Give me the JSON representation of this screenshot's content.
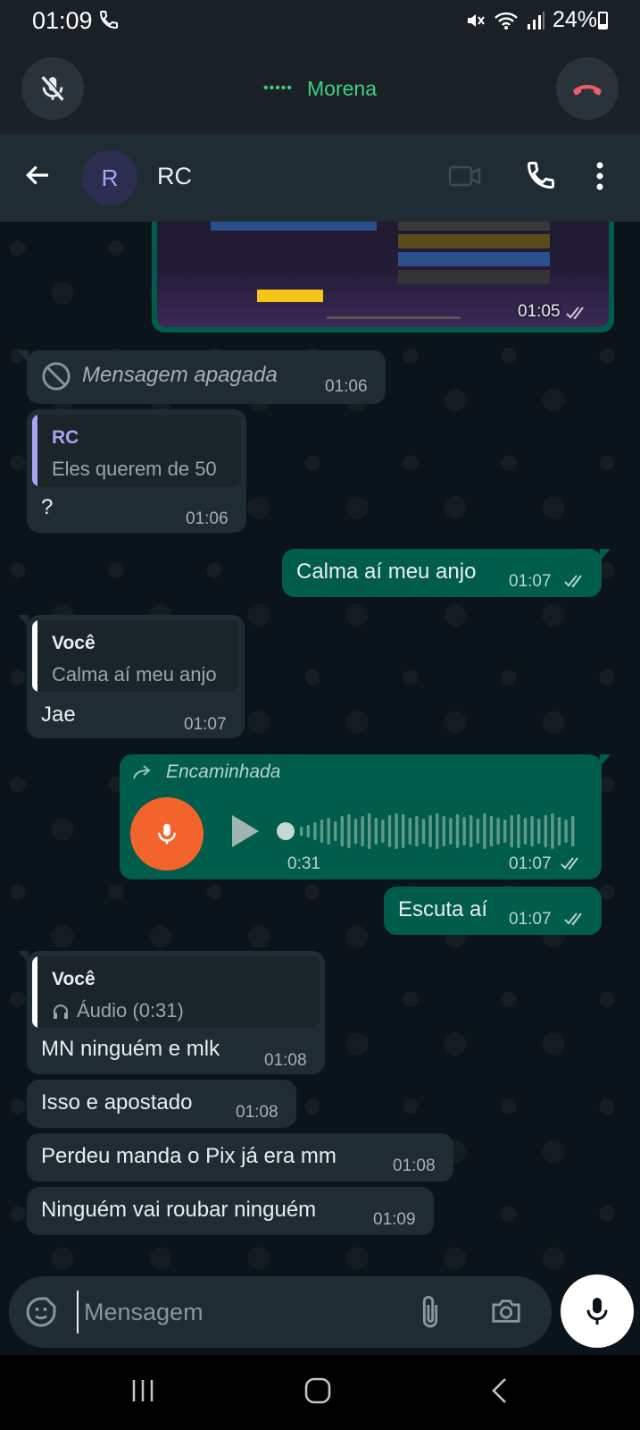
{
  "status_bar": {
    "time": "01:09",
    "battery": "24%"
  },
  "call": {
    "name": "Morena",
    "dots": "•••••"
  },
  "header": {
    "avatar_letter": "R",
    "title": "RC"
  },
  "media_message": {
    "time": "01:05"
  },
  "messages": {
    "deleted": {
      "text": "Mensagem apagada",
      "time": "01:06"
    },
    "m1": {
      "quote_name": "RC",
      "quote_text": "Eles querem de 50",
      "text": "?",
      "time": "01:06"
    },
    "m2": {
      "text": "Calma aí meu anjo",
      "time": "01:07"
    },
    "m3": {
      "quote_name": "Você",
      "quote_text": "Calma aí meu anjo",
      "text": "Jae",
      "time": "01:07"
    },
    "voice": {
      "forwarded_label": "Encaminhada",
      "duration": "0:31",
      "time": "01:07",
      "progress": 0
    },
    "m4": {
      "text": "Escuta aí",
      "time": "01:07"
    },
    "m5": {
      "quote_name": "Você",
      "quote_text": "Áudio (0:31)",
      "text": "MN ninguém e mlk",
      "time": "01:08"
    },
    "m6": {
      "text": "Isso e apostado",
      "time": "01:08"
    },
    "m7": {
      "text": "Perdeu manda o Pix já era mm",
      "time": "01:08"
    },
    "m8": {
      "text": "Ninguém vai roubar ninguém",
      "time": "01:09"
    }
  },
  "input": {
    "placeholder": "Mensagem"
  },
  "colors": {
    "accent": "#005c4b",
    "incoming": "#202c33",
    "call_green": "#3fd180",
    "hangup_red": "#f15c6d",
    "voice_orange": "#f3642c",
    "quote_purple": "#a9a4f4",
    "quote_green": "#06cf9c"
  }
}
